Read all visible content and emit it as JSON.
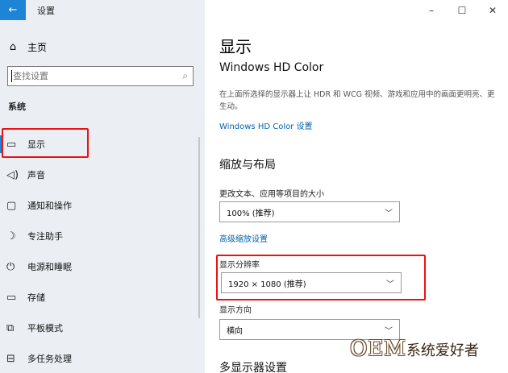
{
  "window": {
    "title": "设置",
    "controls": {
      "minimize": "–",
      "maximize": "☐",
      "close": "✕"
    }
  },
  "sidebar": {
    "back_icon": "←",
    "home": {
      "icon": "⌂",
      "label": "主页"
    },
    "search": {
      "placeholder": "查找设置",
      "icon": "⌕"
    },
    "section": "系统",
    "items": [
      {
        "icon": "▭",
        "label": "显示",
        "selected": true
      },
      {
        "icon": "◁)",
        "label": "声音"
      },
      {
        "icon": "▢",
        "label": "通知和操作"
      },
      {
        "icon": "☽",
        "label": "专注助手"
      },
      {
        "icon": "⏻",
        "label": "电源和睡眠"
      },
      {
        "icon": "▭",
        "label": "存储"
      },
      {
        "icon": "⧉",
        "label": "平板模式"
      },
      {
        "icon": "⊟",
        "label": "多任务处理"
      }
    ]
  },
  "main": {
    "title": "显示",
    "hdr_heading": "Windows HD Color",
    "hdr_description": "在上面所选择的显示器上让 HDR 和 WCG 视频、游戏和应用中的画面更明亮、更生动。",
    "hdr_link": "Windows HD Color 设置",
    "scale_heading": "缩放与布局",
    "scale_label": "更改文本、应用等项目的大小",
    "scale_value": "100% (推荐)",
    "advanced_link": "高级缩放设置",
    "resolution_label": "显示分辨率",
    "resolution_value": "1920 × 1080 (推荐)",
    "orientation_label": "显示方向",
    "orientation_value": "横向",
    "multi_heading": "多显示器设置"
  },
  "watermark": {
    "brand": "OEM",
    "text": "系统爱好者"
  },
  "colors": {
    "accent": "#1e84d6",
    "link": "#0063b1",
    "highlight": "#e11111",
    "sidebar_bg": "#ebeef3"
  }
}
